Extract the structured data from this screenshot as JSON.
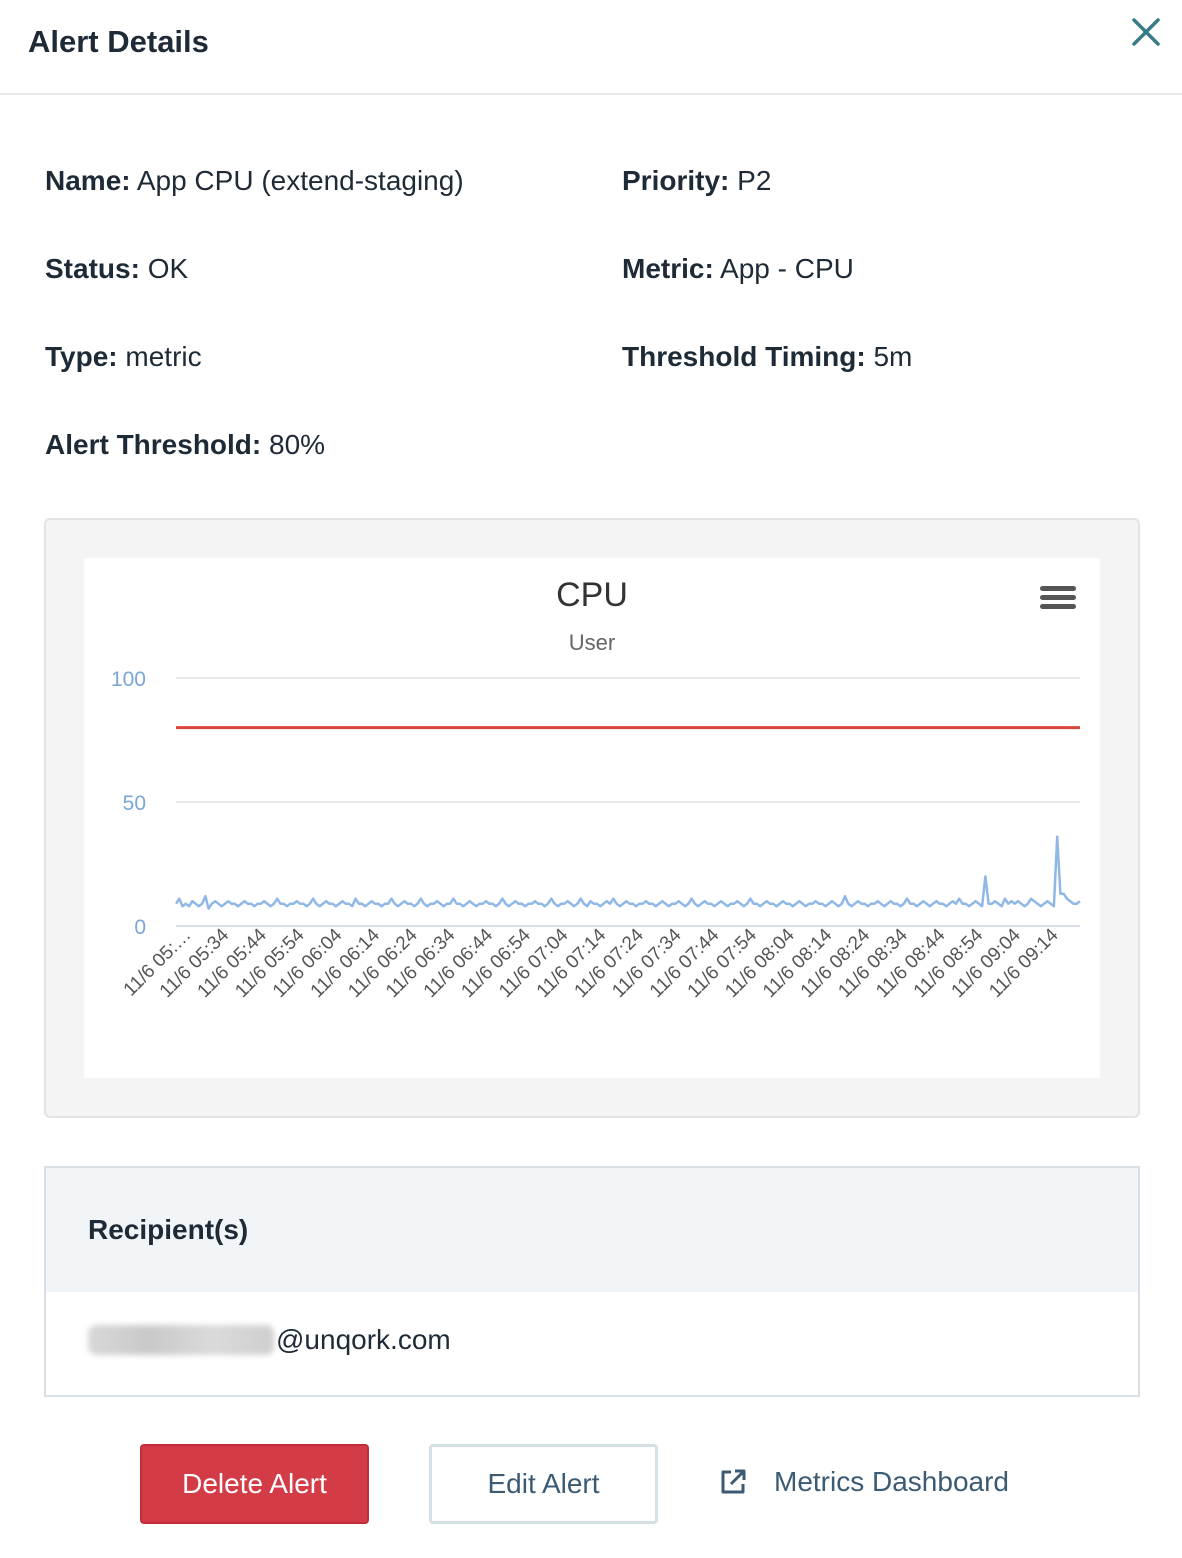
{
  "header": {
    "title": "Alert Details",
    "close_icon": "close-icon"
  },
  "details": {
    "name": {
      "label": "Name:",
      "value": "App CPU (extend-staging)"
    },
    "priority": {
      "label": "Priority:",
      "value": "P2"
    },
    "status": {
      "label": "Status:",
      "value": "OK"
    },
    "metric": {
      "label": "Metric:",
      "value": "App - CPU"
    },
    "type": {
      "label": "Type:",
      "value": "metric"
    },
    "threshold_timing": {
      "label": "Threshold Timing:",
      "value": "5m"
    },
    "alert_threshold": {
      "label": "Alert Threshold:",
      "value": "80%"
    }
  },
  "chart_data": {
    "type": "line",
    "title": "CPU",
    "subtitle": "User",
    "ylim": [
      0,
      100
    ],
    "yticks": [
      0,
      50,
      100
    ],
    "grid": true,
    "threshold": {
      "value": 80,
      "color": "#d9453b"
    },
    "series_color": "#8fb8e6",
    "x_tick_labels": [
      "11/6 05:…",
      "11/6 05:34",
      "11/6 05:44",
      "11/6 05:54",
      "11/6 06:04",
      "11/6 06:14",
      "11/6 06:24",
      "11/6 06:34",
      "11/6 06:44",
      "11/6 06:54",
      "11/6 07:04",
      "11/6 07:14",
      "11/6 07:24",
      "11/6 07:34",
      "11/6 07:44",
      "11/6 07:54",
      "11/6 08:04",
      "11/6 08:14",
      "11/6 08:24",
      "11/6 08:34",
      "11/6 08:44",
      "11/6 08:54",
      "11/6 09:04",
      "11/6 09:14"
    ],
    "series": [
      {
        "values": [
          9,
          11,
          8,
          9,
          8,
          10,
          9,
          8,
          9,
          12,
          7,
          9,
          10,
          9,
          8,
          9,
          10,
          9,
          9,
          8,
          9,
          10,
          9,
          9,
          8,
          9,
          9,
          10,
          9,
          8,
          9,
          11,
          9,
          9,
          8,
          9,
          9,
          10,
          9,
          9,
          8,
          9,
          11,
          9,
          8,
          9,
          10,
          9,
          9,
          8,
          9,
          10,
          9,
          9,
          8,
          11,
          9,
          9,
          8,
          9,
          10,
          9,
          9,
          8,
          9,
          9,
          11,
          9,
          8,
          9,
          10,
          9,
          9,
          8,
          9,
          11,
          9,
          8,
          9,
          9,
          10,
          9,
          8,
          9,
          9,
          11,
          9,
          9,
          8,
          9,
          10,
          9,
          8,
          9,
          9,
          10,
          9,
          9,
          8,
          9,
          11,
          9,
          8,
          9,
          10,
          9,
          9,
          8,
          9,
          9,
          10,
          9,
          9,
          8,
          9,
          11,
          9,
          8,
          9,
          9,
          10,
          9,
          8,
          9,
          11,
          9,
          8,
          10,
          9,
          9,
          8,
          9,
          10,
          9,
          11,
          9,
          8,
          9,
          10,
          9,
          9,
          8,
          9,
          9,
          10,
          9,
          9,
          8,
          9,
          10,
          9,
          8,
          9,
          9,
          10,
          9,
          8,
          9,
          11,
          9,
          8,
          9,
          10,
          9,
          9,
          8,
          9,
          10,
          9,
          8,
          9,
          9,
          10,
          9,
          8,
          9,
          11,
          9,
          9,
          8,
          9,
          10,
          9,
          9,
          8,
          9,
          10,
          9,
          9,
          8,
          9,
          10,
          9,
          8,
          9,
          9,
          10,
          9,
          9,
          8,
          9,
          10,
          9,
          8,
          9,
          12,
          9,
          8,
          9,
          10,
          9,
          9,
          8,
          9,
          9,
          10,
          9,
          8,
          9,
          10,
          9,
          9,
          8,
          9,
          11,
          9,
          9,
          8,
          9,
          10,
          9,
          8,
          9,
          10,
          9,
          9,
          8,
          9,
          10,
          9,
          11,
          9,
          9,
          8,
          9,
          10,
          9,
          8,
          20,
          9,
          9,
          10,
          9,
          8,
          11,
          9,
          10,
          9,
          10,
          9,
          8,
          9,
          11,
          10,
          9,
          8,
          9,
          10,
          9,
          8,
          36,
          13,
          13,
          11,
          10,
          9,
          9,
          10
        ]
      }
    ]
  },
  "recipients": {
    "title": "Recipient(s)",
    "email_domain": "@unqork.com"
  },
  "actions": {
    "delete_label": "Delete Alert",
    "edit_label": "Edit Alert",
    "metrics_label": "Metrics Dashboard"
  }
}
